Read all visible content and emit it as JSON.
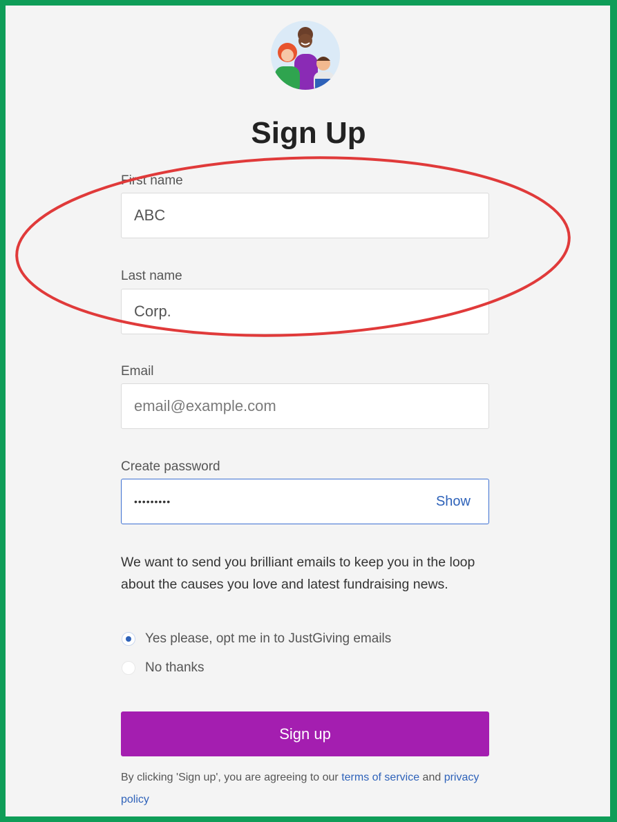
{
  "page": {
    "title": "Sign Up"
  },
  "form": {
    "first_name": {
      "label": "First name",
      "value": "ABC"
    },
    "last_name": {
      "label": "Last name",
      "value": "Corp."
    },
    "email": {
      "label": "Email",
      "placeholder": "email@example.com"
    },
    "password": {
      "label": "Create password",
      "value": "•••••••••",
      "toggle_label": "Show"
    }
  },
  "marketing": {
    "notice": "We want to send you brilliant emails to keep you in the loop about the causes you love and latest fundraising news.",
    "options": [
      {
        "label": "Yes please, opt me in to JustGiving emails",
        "selected": true
      },
      {
        "label": "No thanks",
        "selected": false
      }
    ]
  },
  "actions": {
    "signup_label": "Sign up"
  },
  "legal": {
    "prefix": "By clicking 'Sign up', you are agreeing to our ",
    "terms_link": "terms of service",
    "middle": " and ",
    "privacy_link": "privacy policy"
  },
  "colors": {
    "frame_border": "#0f9d58",
    "annotation_circle": "#e03a3a",
    "primary_button": "#a41eb0",
    "link": "#2e62b9"
  }
}
